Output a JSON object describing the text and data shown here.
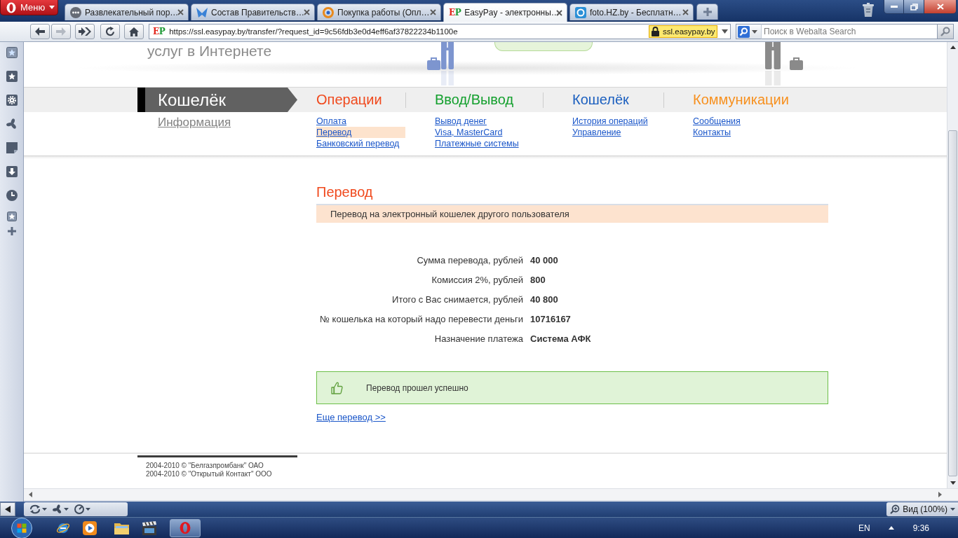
{
  "browser": {
    "menu_label": "Меню",
    "tabs": [
      {
        "title": "Развлекательный пор…",
        "kind": "chat",
        "selected": false
      },
      {
        "title": "Состав Правительств…",
        "kind": "emblem",
        "selected": false
      },
      {
        "title": "Покупка работы (Опл…",
        "kind": "ring",
        "selected": false
      },
      {
        "title": "EasyPay - электронны…",
        "kind": "logo",
        "logo": "EP",
        "selected": true
      },
      {
        "title": "foto.HZ.by - Бесплатн…",
        "kind": "photo",
        "selected": false
      }
    ],
    "forward_disabled": true,
    "address": {
      "logo": "EP",
      "url": "https://ssl.easypay.by/transfer/?request_id=9c56fdb3e0d4eff6af37822234b1100e",
      "site_badge": "ssl.easypay.by"
    },
    "search": {
      "placeholder": "Поиск в Webalta Search"
    }
  },
  "page": {
    "slogan": "услуг в Интернете",
    "section_tab": "Кошелёк",
    "section_link": "Информация",
    "menu": [
      {
        "title": "Операции",
        "color": "#f04a1e",
        "links": [
          {
            "label": "Оплата",
            "selected": false
          },
          {
            "label": "Перевод",
            "selected": true
          },
          {
            "label": "Банковский перевод",
            "selected": false
          }
        ]
      },
      {
        "title": "Ввод/Вывод",
        "color": "#14a02e",
        "links": [
          {
            "label": "Вывод денег",
            "selected": false
          },
          {
            "label": "Visa, MasterCard",
            "selected": false
          },
          {
            "label": "Платежные системы",
            "selected": false
          }
        ]
      },
      {
        "title": "Кошелёк",
        "color": "#1b5fbf",
        "links": [
          {
            "label": "История операций",
            "selected": false
          },
          {
            "label": "Управление",
            "selected": false
          }
        ]
      },
      {
        "title": "Коммуникации",
        "color": "#f7901e",
        "links": [
          {
            "label": "Сообщения",
            "selected": false
          },
          {
            "label": "Контакты",
            "selected": false
          }
        ]
      }
    ]
  },
  "content": {
    "title": "Перевод",
    "subtitle": "Перевод на электронный кошелек другого пользователя",
    "details": [
      {
        "label": "Сумма перевода, рублей",
        "value": "40 000"
      },
      {
        "label": "Комиссия 2%, рублей",
        "value": "800"
      },
      {
        "label": "Итого с Вас снимается, рублей",
        "value": "40 800"
      },
      {
        "label": "№ кошелька на который надо перевести деньги",
        "value": "10716167"
      },
      {
        "label": "Назначение платежа",
        "value": "Система АФК"
      }
    ],
    "success_message": "Перевод прошел успешно",
    "more_link": "Еще перевод >>"
  },
  "footer": [
    "2004-2010 © \"Белгазпромбанк\" ОАО",
    "2004-2010 © \"Открытый Контакт\" ООО"
  ],
  "status_bar": {
    "zoom_label": "Вид (100%)"
  },
  "taskbar": {
    "language": "EN",
    "time": "9:36"
  }
}
